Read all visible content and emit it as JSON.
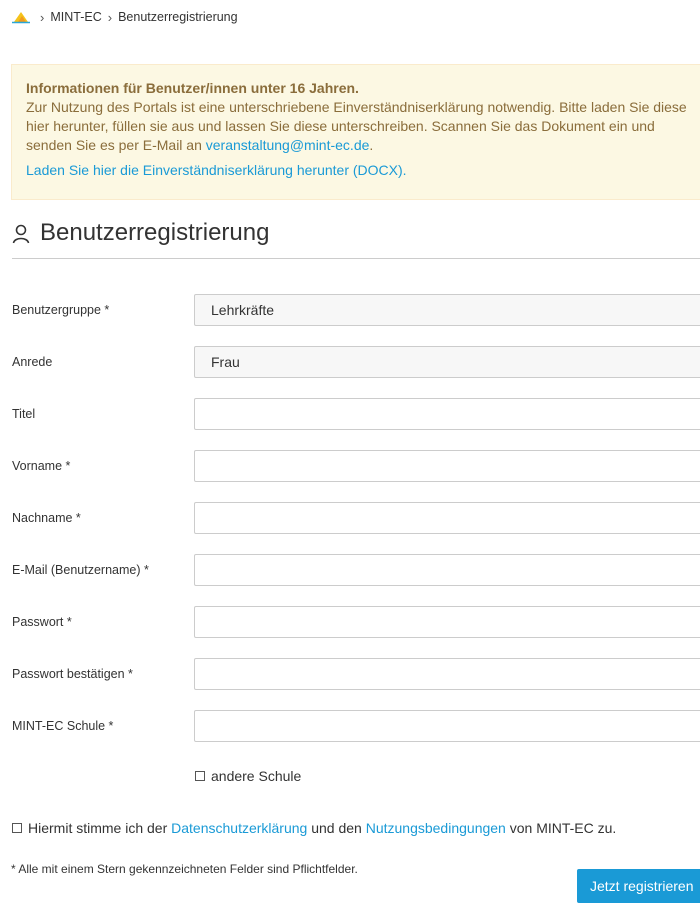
{
  "breadcrumb": {
    "items": [
      "MINT-EC",
      "Benutzerregistrierung"
    ],
    "separator": "›"
  },
  "notice": {
    "title": "Informationen für Benutzer/innen unter 16 Jahren.",
    "body": "Zur Nutzung des Portals ist eine unterschriebene Einverständniserklärung notwendig. Bitte laden Sie diese hier herunter, füllen sie aus und lassen Sie diese unterschreiben. Scannen Sie das Dokument ein und senden Sie es per E-Mail an ",
    "email_link": "veranstaltung@mint-ec.de",
    "after_email": ".",
    "download_link": "Laden Sie hier die Einverständniserklärung herunter (DOCX)."
  },
  "page": {
    "title": "Benutzerregistrierung"
  },
  "form": {
    "benutzergruppe": {
      "label": "Benutzergruppe *",
      "value": "Lehrkräfte"
    },
    "anrede": {
      "label": "Anrede",
      "value": "Frau"
    },
    "titel": {
      "label": "Titel",
      "value": ""
    },
    "vorname": {
      "label": "Vorname *",
      "value": ""
    },
    "nachname": {
      "label": "Nachname *",
      "value": ""
    },
    "email": {
      "label": "E-Mail (Benutzername) *",
      "value": ""
    },
    "passwort": {
      "label": "Passwort *",
      "value": ""
    },
    "passwort_bestaetigen": {
      "label": "Passwort bestätigen *",
      "value": ""
    },
    "schule": {
      "label": "MINT-EC Schule *",
      "value": ""
    },
    "andere_schule": {
      "label": "andere Schule",
      "checked": false
    },
    "consent": {
      "checked": false,
      "text_before": "Hiermit stimme ich der ",
      "link_privacy": "Datenschutzerklärung",
      "text_middle": " und den ",
      "link_terms": "Nutzungsbedingungen",
      "text_after": " von MINT-EC zu."
    },
    "required_note": "* Alle mit einem Stern gekennzeichneten Felder sind Pflichtfelder.",
    "submit_label": "Jetzt registrieren"
  },
  "colors": {
    "link": "#1a9ad6",
    "notice_bg": "#fcf8e3",
    "notice_text": "#8a6d3b",
    "button": "#1a9ad6"
  },
  "icons": {
    "logo": "mint-ec-logo-icon",
    "user": "user-icon",
    "caret": "chevron-down-icon"
  }
}
